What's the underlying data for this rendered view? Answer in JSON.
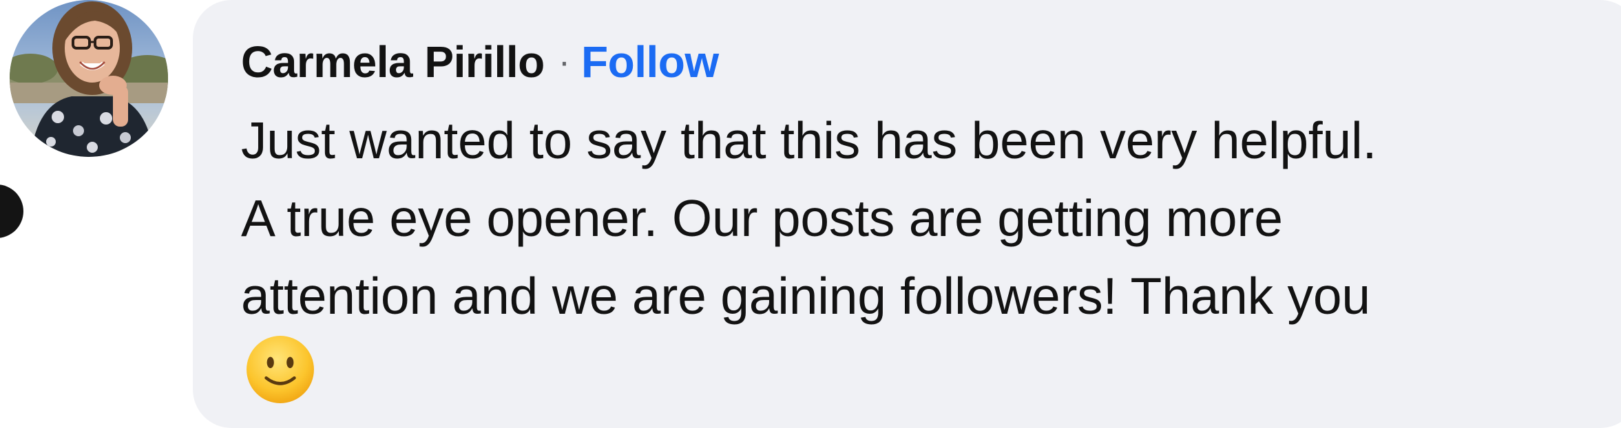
{
  "comment": {
    "author": "Carmela Pirillo",
    "separator": "·",
    "follow_label": "Follow",
    "lines": [
      "Just wanted to say that this has been very helpful.",
      "A true eye opener. Our posts are getting more",
      "attention and we are gaining followers! Thank you"
    ],
    "emoji": "slightly-smiling-face-icon"
  },
  "avatar": {
    "icon": "avatar"
  },
  "colors": {
    "bubble": "#f0f1f5",
    "follow": "#1b6bf3",
    "text": "#121212"
  }
}
